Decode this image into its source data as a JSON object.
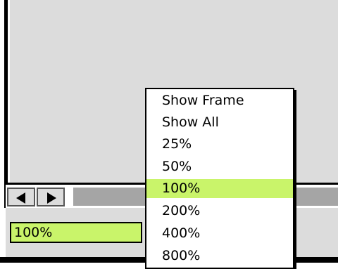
{
  "zoom": {
    "current_value": "100%"
  },
  "popup_menu": {
    "items": [
      "Show Frame",
      "Show All",
      "25%",
      "50%",
      "100%",
      "200%",
      "400%",
      "800%"
    ],
    "selected_index": 4
  },
  "colors": {
    "highlight": "#c9f46a",
    "track": "#a5a5a5",
    "background": "#dcdcdc"
  },
  "icons": {
    "scroll_left": "left-arrow-icon",
    "scroll_right": "right-arrow-icon"
  }
}
